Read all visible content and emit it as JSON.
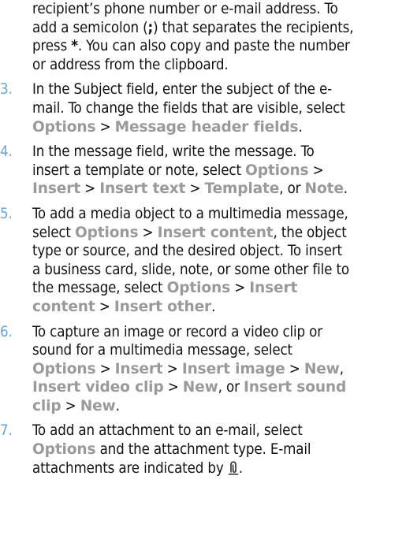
{
  "lines": {
    "c1": "recipient’s phone number or e-mail address. To",
    "c2a": "add a semicolon (",
    "c2sym": ";",
    "c2b": ") that separates the recipients,",
    "c3a": "press ",
    "c3sym": "*",
    "c3b": ". You can also copy and paste the number",
    "c4": "or address from the clipboard.",
    "s3num": "3.",
    "s3l1": "In the Subject field, enter the subject of the e-",
    "s3l2": "mail. To change the fields that are visible, select",
    "s3k1": "Options",
    "s3k2": "Message header fields",
    "s3end": ".",
    "s4num": "4.",
    "s4l1": "In the message field, write the message. To",
    "s4l2a": "insert a template or note, select ",
    "s4k1": "Options",
    "s4k2": "Insert",
    "s4k3": "Insert text",
    "s4k4": "Template",
    "s4or": ", or ",
    "s4k5": "Note",
    "s4end": ".",
    "s5num": "5.",
    "s5l1": "To add a media object to a multimedia message,",
    "s5l2a": "select ",
    "s5k1": "Options",
    "s5k2": "Insert content",
    "s5l2b": ", the object",
    "s5l3": "type or source, and the desired object. To insert",
    "s5l4": "a business card, slide, note, or some other file to",
    "s5l5a": "the message, select ",
    "s5k3": "Options",
    "s5k4": "Insert",
    "s5k5": "content",
    "s5k6": "Insert other",
    "s5end": ".",
    "s6num": "6.",
    "s6l1": "To capture an image or record a video clip or",
    "s6l2": "sound for a multimedia message, select",
    "s6k1": "Options",
    "s6k2": "Insert",
    "s6k3": "Insert image",
    "s6k4": "New",
    "s6c1": ",",
    "s6k5": "Insert video clip",
    "s6k6": "New",
    "s6or": ", or ",
    "s6k7": "Insert sound",
    "s6k8": "clip",
    "s6k9": "New",
    "s6end": ".",
    "s7num": "7.",
    "s7l1": "To add an attachment to an e-mail, select",
    "s7k1": "Options",
    "s7l2b": " and the attachment type. E-mail",
    "s7l3a": "attachments are indicated by ",
    "s7end": "."
  },
  "separator": " > ",
  "icons": {
    "attachment": "paperclip-icon"
  },
  "colors": {
    "step_number": "#6aa3d6",
    "menu_keyword": "#9a9a9a",
    "body_text": "#111111"
  }
}
